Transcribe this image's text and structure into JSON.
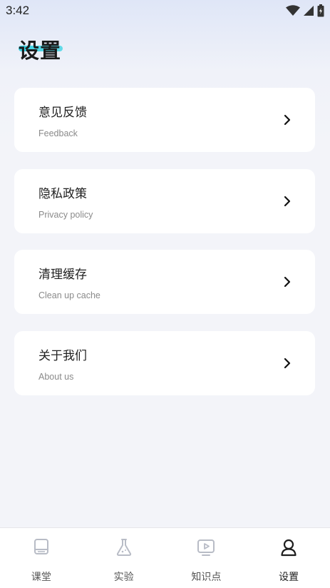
{
  "status_bar": {
    "time": "3:42",
    "icons": [
      "wifi-icon",
      "signal-icon",
      "battery-icon"
    ]
  },
  "page": {
    "title": "设置",
    "accent_color": "#23cfe0"
  },
  "settings": [
    {
      "title": "意见反馈",
      "subtitle": "Feedback",
      "icon": "chevron-right-icon"
    },
    {
      "title": "隐私政策",
      "subtitle": "Privacy policy",
      "icon": "chevron-right-icon"
    },
    {
      "title": "清理缓存",
      "subtitle": "Clean up cache",
      "icon": "chevron-right-icon"
    },
    {
      "title": "关于我们",
      "subtitle": "About us",
      "icon": "chevron-right-icon"
    }
  ],
  "bottom_nav": {
    "active_index": 3,
    "items": [
      {
        "label": "课堂",
        "icon": "book-icon"
      },
      {
        "label": "实验",
        "icon": "flask-icon"
      },
      {
        "label": "知识点",
        "icon": "video-play-icon"
      },
      {
        "label": "设置",
        "icon": "user-icon"
      }
    ]
  }
}
